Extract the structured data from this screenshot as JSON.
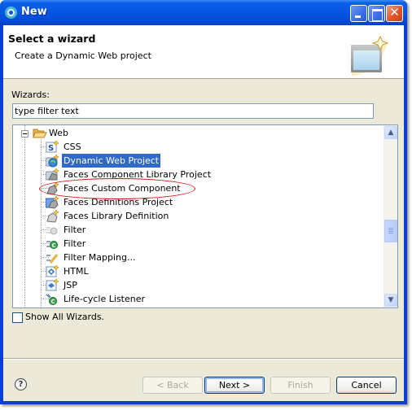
{
  "window": {
    "title": "New",
    "controls": {
      "minimize": "minimize",
      "maximize": "maximize",
      "close": "✕"
    }
  },
  "header": {
    "title": "Select a wizard",
    "description": "Create a Dynamic Web project"
  },
  "wizards_label": "Wizards:",
  "filter": {
    "value": "type filter text",
    "placeholder": "type filter text"
  },
  "tree": {
    "category": {
      "label": "Web",
      "icon": "folder-open-icon",
      "expanded": true
    },
    "items": [
      {
        "label": "CSS",
        "icon": "css-wizard-icon",
        "selected": false
      },
      {
        "label": "Dynamic Web Project",
        "icon": "web-project-icon",
        "selected": true
      },
      {
        "label": "Faces Component Library Project",
        "icon": "faces-library-project-icon",
        "selected": false
      },
      {
        "label": "Faces Custom Component",
        "icon": "faces-component-icon",
        "selected": false
      },
      {
        "label": "Faces Definitions Project",
        "icon": "faces-definitions-icon",
        "selected": false
      },
      {
        "label": "Faces Library Definition",
        "icon": "faces-library-icon",
        "selected": false
      },
      {
        "label": "Filter",
        "icon": "filter-disabled-icon",
        "selected": false
      },
      {
        "label": "Filter",
        "icon": "filter-icon",
        "selected": false
      },
      {
        "label": "Filter Mapping...",
        "icon": "filter-mapping-icon",
        "selected": false
      },
      {
        "label": "HTML",
        "icon": "html-file-icon",
        "selected": false
      },
      {
        "label": "JSP",
        "icon": "jsp-file-icon",
        "selected": false
      },
      {
        "label": "Life-cycle Listener",
        "icon": "listener-icon",
        "selected": false
      }
    ]
  },
  "show_all": {
    "label": "Show All Wizards.",
    "checked": false
  },
  "buttons": {
    "help": "?",
    "back": "< Back",
    "next": "Next >",
    "finish": "Finish",
    "cancel": "Cancel"
  },
  "colors": {
    "titlebar": "#0656e2",
    "selection": "#316ac5",
    "annotation_ellipse": "#d01010",
    "dialog_bg": "#ece9d8"
  }
}
